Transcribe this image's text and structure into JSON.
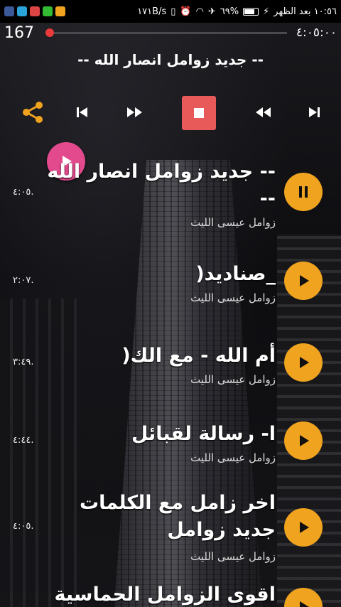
{
  "status_bar": {
    "time_text": "١٠:٥٦ بعد الظهر",
    "battery_text": "٦٩%",
    "speed_text": "١٧١B/s"
  },
  "player": {
    "position_counter": "167",
    "duration_text": "٤:٠٥:٠٠",
    "progress_fraction": 0.0,
    "now_playing_title": "-- جديد زوامل انصار الله --",
    "accent_color": "#e83a3a"
  },
  "tracks": [
    {
      "title_line1": "-- جديد زوامل انصار الله",
      "title_line2": "--",
      "artist": "زوامل عيسى الليث",
      "duration": "٤:٠٥.",
      "state": "playing"
    },
    {
      "title_line1": "_صناديد(",
      "title_line2": "",
      "artist": "زوامل عيسى الليث",
      "duration": "٢:٠٧.",
      "state": "paused"
    },
    {
      "title_line1": "أم الله - مع الك(",
      "title_line2": "",
      "artist": "زوامل عيسى الليث",
      "duration": "٣:٤٩.",
      "state": "paused"
    },
    {
      "title_line1": "ا- رسالة لقبائل",
      "title_line2": "",
      "artist": "زوامل عيسى الليث",
      "duration": "٤:٤٤.",
      "state": "paused"
    },
    {
      "title_line1": "اخر زامل مع الكلمات",
      "title_line2": "جديد زوامل",
      "artist": "زوامل عيسى الليث",
      "duration": "٤:٠٥.",
      "state": "paused"
    },
    {
      "title_line1": "اقوى الزوامل الحماسية",
      "title_line2": "",
      "artist": "",
      "duration": "",
      "state": "paused"
    }
  ],
  "colors": {
    "play_button": "#f0a31e",
    "stop_button": "#e85a5a",
    "fab": "#e24a8d",
    "share_icon": "#f0a31e"
  },
  "icons": [
    "share-icon",
    "skip-previous-icon",
    "fast-forward-icon",
    "stop-icon",
    "rewind-icon",
    "skip-next-icon",
    "play-icon",
    "pause-icon"
  ]
}
